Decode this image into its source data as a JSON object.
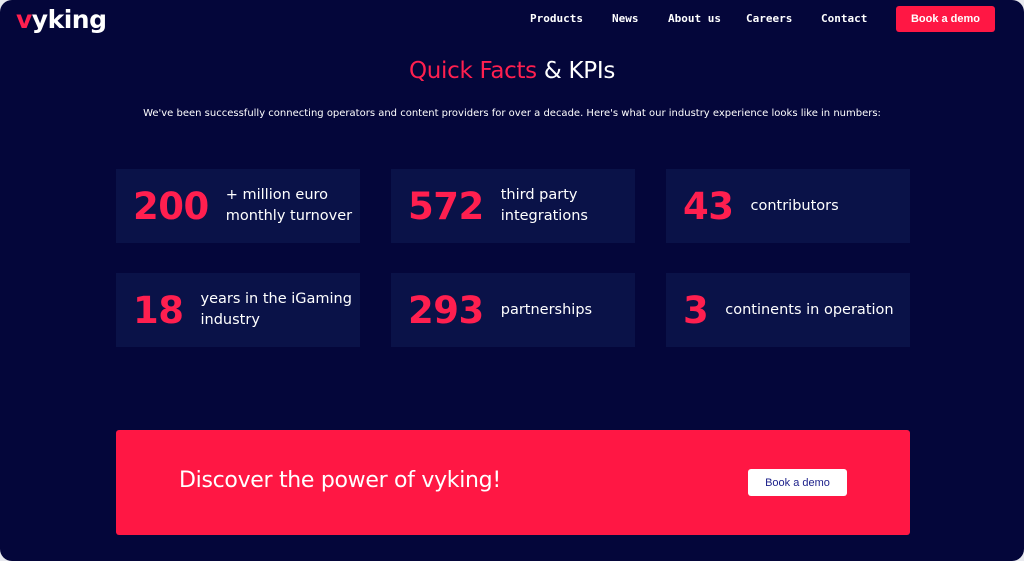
{
  "header": {
    "logo_accent": "v",
    "logo_rest": "yking",
    "nav": [
      "Products",
      "News",
      "About us",
      "Careers",
      "Contact"
    ],
    "cta_label": "Book a demo"
  },
  "section": {
    "title_accent": "Quick Facts",
    "title_rest": " & KPIs",
    "intro": "We've been successfully connecting operators and content providers for over a decade. Here's what our industry experience looks like in numbers:"
  },
  "kpis": [
    {
      "value": "200",
      "line1": "+ million euro",
      "line2": "monthly turnover"
    },
    {
      "value": "572",
      "line1": "third party",
      "line2": "integrations"
    },
    {
      "value": "43",
      "line1": "contributors",
      "line2": ""
    },
    {
      "value": "18",
      "line1": "years in the iGaming",
      "line2": "industry"
    },
    {
      "value": "293",
      "line1": "partnerships",
      "line2": ""
    },
    {
      "value": "3",
      "line1": "continents in operation",
      "line2": ""
    }
  ],
  "cta": {
    "text": "Discover the power of vyking!",
    "button": "Book a demo"
  },
  "colors": {
    "background": "#04063a",
    "card": "#0a1248",
    "accent": "#ff1744"
  }
}
